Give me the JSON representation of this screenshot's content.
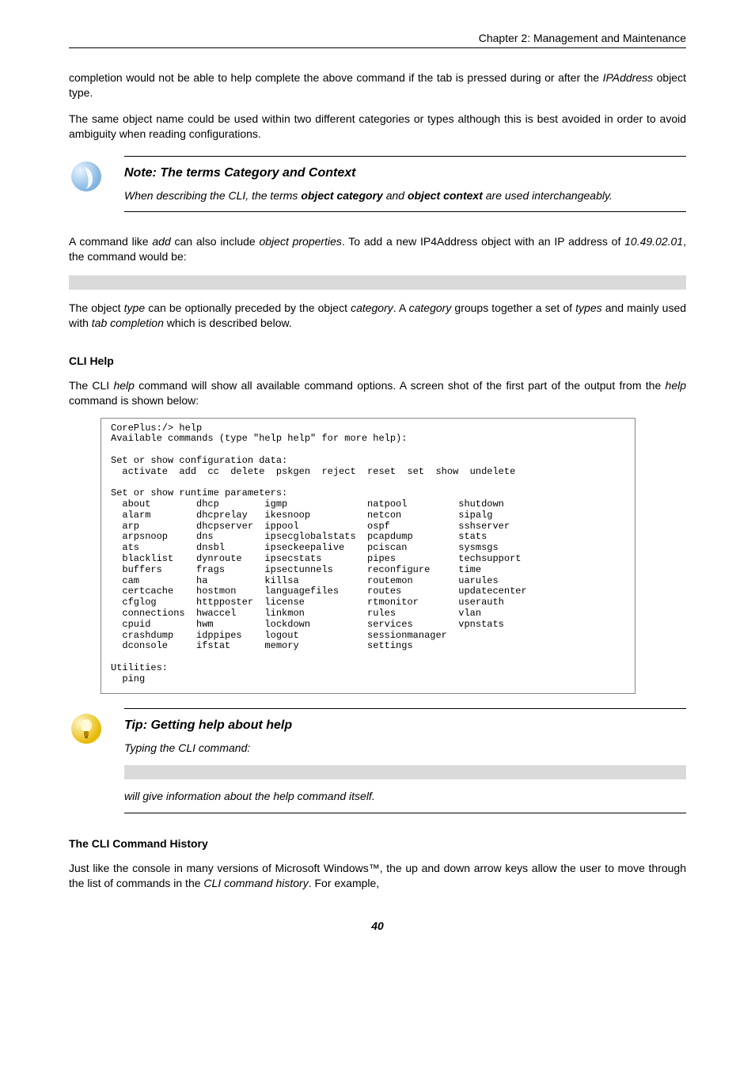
{
  "header": {
    "chapter": "Chapter 2: Management and Maintenance"
  },
  "para1_a": "completion would not be able to help complete the above command if the tab is pressed during or after the ",
  "para1_i": "IPAddress",
  "para1_b": " object type.",
  "para2": "The same object name could be used within two different categories or types although this is best avoided in order to avoid ambiguity when reading configurations.",
  "note": {
    "title": "Note: The terms Category and Context",
    "text_a": "When describing the CLI, the terms ",
    "text_b1": "object category",
    "text_mid": " and ",
    "text_b2": "object context",
    "text_c": " are used interchangeably."
  },
  "para3_a": "A command like ",
  "para3_i1": "add",
  "para3_b": " can also include ",
  "para3_i2": "object properties",
  "para3_c": ". To add a new IP4Address object with an IP address of ",
  "para3_i3": "10.49.02.01",
  "para3_d": ", the command would be:",
  "para4_a": "The object ",
  "para4_i1": "type",
  "para4_b": " can be optionally preceded by the object ",
  "para4_i2": "category",
  "para4_c": ". A ",
  "para4_i3": "category",
  "para4_d": " groups together a set of ",
  "para4_i4": "types",
  "para4_e": " and mainly used with ",
  "para4_i5": "tab completion",
  "para4_f": " which is described below.",
  "heading_cli_help": "CLI Help",
  "para5_a": "The CLI ",
  "para5_i1": "help",
  "para5_b": " command will show all available command options. A screen shot of the first part of the output from the ",
  "para5_i2": "help",
  "para5_c": " command is shown below:",
  "cli_output": "CorePlus:/> help\nAvailable commands (type \"help help\" for more help):\n\nSet or show configuration data:\n  activate  add  cc  delete  pskgen  reject  reset  set  show  undelete\n\nSet or show runtime parameters:\n  about        dhcp        igmp              natpool         shutdown\n  alarm        dhcprelay   ikesnoop          netcon          sipalg\n  arp          dhcpserver  ippool            ospf            sshserver\n  arpsnoop     dns         ipsecglobalstats  pcapdump        stats\n  ats          dnsbl       ipseckeepalive    pciscan         sysmsgs\n  blacklist    dynroute    ipsecstats        pipes           techsupport\n  buffers      frags       ipsectunnels      reconfigure     time\n  cam          ha          killsa            routemon        uarules\n  certcache    hostmon     languagefiles     routes          updatecenter\n  cfglog       httpposter  license           rtmonitor       userauth\n  connections  hwaccel     linkmon           rules           vlan\n  cpuid        hwm         lockdown          services        vpnstats\n  crashdump    idppipes    logout            sessionmanager\n  dconsole     ifstat      memory            settings\n\nUtilities:\n  ping",
  "tip": {
    "title": "Tip: Getting help about help",
    "text1": "Typing the CLI command:",
    "text2": "will give information about the help command itself."
  },
  "heading_cli_history": "The CLI Command History",
  "para6_a": "Just like the console in many versions of Microsoft Windows™, the up and down arrow keys allow the user to move through the list of commands in the ",
  "para6_i1": "CLI command history",
  "para6_b": ". For example,",
  "page_number": "40"
}
